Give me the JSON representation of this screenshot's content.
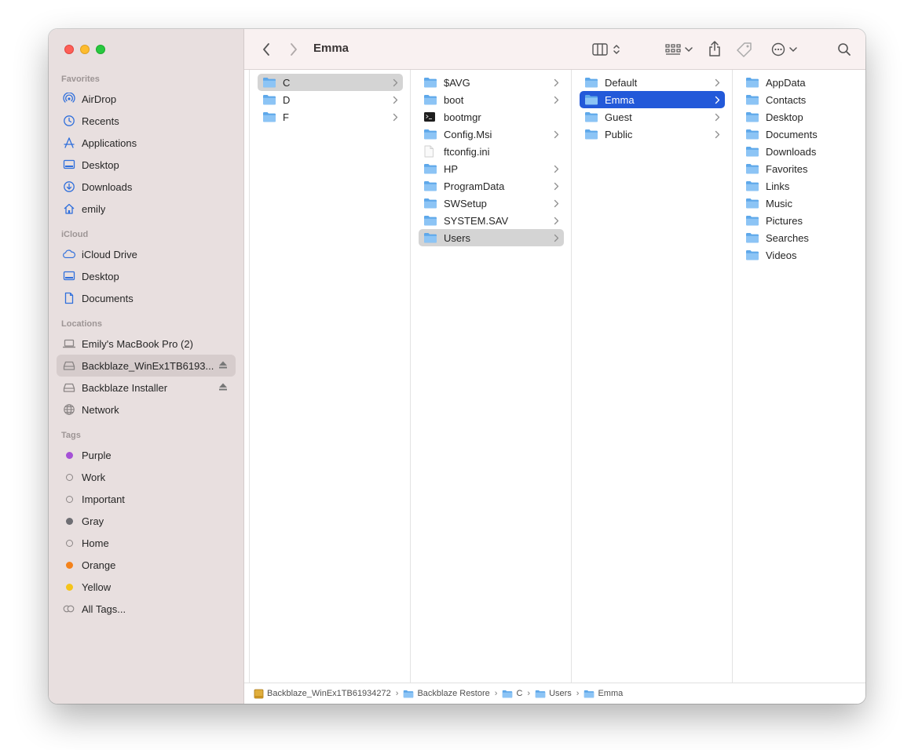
{
  "window": {
    "title": "Emma"
  },
  "sidebar": {
    "sections": [
      {
        "title": "Favorites",
        "items": [
          {
            "label": "AirDrop",
            "icon": "airdrop-icon"
          },
          {
            "label": "Recents",
            "icon": "clock-icon"
          },
          {
            "label": "Applications",
            "icon": "applications-icon"
          },
          {
            "label": "Desktop",
            "icon": "desktop-icon"
          },
          {
            "label": "Downloads",
            "icon": "download-icon"
          },
          {
            "label": "emily",
            "icon": "home-icon"
          }
        ]
      },
      {
        "title": "iCloud",
        "items": [
          {
            "label": "iCloud Drive",
            "icon": "cloud-icon"
          },
          {
            "label": "Desktop",
            "icon": "desktop-icon"
          },
          {
            "label": "Documents",
            "icon": "document-icon"
          }
        ]
      },
      {
        "title": "Locations",
        "items": [
          {
            "label": "Emily's MacBook Pro (2)",
            "icon": "laptop-icon"
          },
          {
            "label": "Backblaze_WinEx1TB6193...",
            "icon": "drive-icon",
            "selected": true,
            "eject": true
          },
          {
            "label": "Backblaze Installer",
            "icon": "drive-icon",
            "eject": true
          },
          {
            "label": "Network",
            "icon": "globe-icon"
          }
        ]
      },
      {
        "title": "Tags",
        "items": [
          {
            "label": "Purple",
            "color": "#a551d6"
          },
          {
            "label": "Work",
            "color": "hollow"
          },
          {
            "label": "Important",
            "color": "hollow"
          },
          {
            "label": "Gray",
            "color": "#6e6e73"
          },
          {
            "label": "Home",
            "color": "hollow"
          },
          {
            "label": "Orange",
            "color": "#f4821b"
          },
          {
            "label": "Yellow",
            "color": "#f5c41a"
          },
          {
            "label": "All Tags...",
            "color": "all"
          }
        ]
      }
    ]
  },
  "columns": [
    {
      "items": [
        {
          "name": "C",
          "type": "folder",
          "state": "active"
        },
        {
          "name": "D",
          "type": "folder"
        },
        {
          "name": "F",
          "type": "folder"
        }
      ]
    },
    {
      "items": [
        {
          "name": "$AVG",
          "type": "folder"
        },
        {
          "name": "boot",
          "type": "folder"
        },
        {
          "name": "bootmgr",
          "type": "exec"
        },
        {
          "name": "Config.Msi",
          "type": "folder"
        },
        {
          "name": "ftconfig.ini",
          "type": "file"
        },
        {
          "name": "HP",
          "type": "folder"
        },
        {
          "name": "ProgramData",
          "type": "folder"
        },
        {
          "name": "SWSetup",
          "type": "folder"
        },
        {
          "name": "SYSTEM.SAV",
          "type": "folder"
        },
        {
          "name": "Users",
          "type": "folder",
          "state": "active"
        }
      ]
    },
    {
      "items": [
        {
          "name": "Default",
          "type": "folder"
        },
        {
          "name": "Emma",
          "type": "folder",
          "state": "focus"
        },
        {
          "name": "Guest",
          "type": "folder"
        },
        {
          "name": "Public",
          "type": "folder"
        }
      ]
    },
    {
      "items": [
        {
          "name": "AppData",
          "type": "folder"
        },
        {
          "name": "Contacts",
          "type": "folder"
        },
        {
          "name": "Desktop",
          "type": "folder"
        },
        {
          "name": "Documents",
          "type": "folder"
        },
        {
          "name": "Downloads",
          "type": "folder"
        },
        {
          "name": "Favorites",
          "type": "folder"
        },
        {
          "name": "Links",
          "type": "folder"
        },
        {
          "name": "Music",
          "type": "folder"
        },
        {
          "name": "Pictures",
          "type": "folder"
        },
        {
          "name": "Searches",
          "type": "folder"
        },
        {
          "name": "Videos",
          "type": "folder"
        }
      ]
    }
  ],
  "pathbar": [
    {
      "label": "Backblaze_WinEx1TB61934272",
      "icon": "drive-icon"
    },
    {
      "label": "Backblaze Restore",
      "icon": "folder-icon"
    },
    {
      "label": "C",
      "icon": "folder-icon"
    },
    {
      "label": "Users",
      "icon": "folder-icon"
    },
    {
      "label": "Emma",
      "icon": "folder-icon"
    }
  ],
  "colors": {
    "accent": "#2359d9",
    "sidebar_icon": "#2f6fdc",
    "folder_light": "#8cc4f5",
    "folder_dark": "#5ea8ea"
  }
}
